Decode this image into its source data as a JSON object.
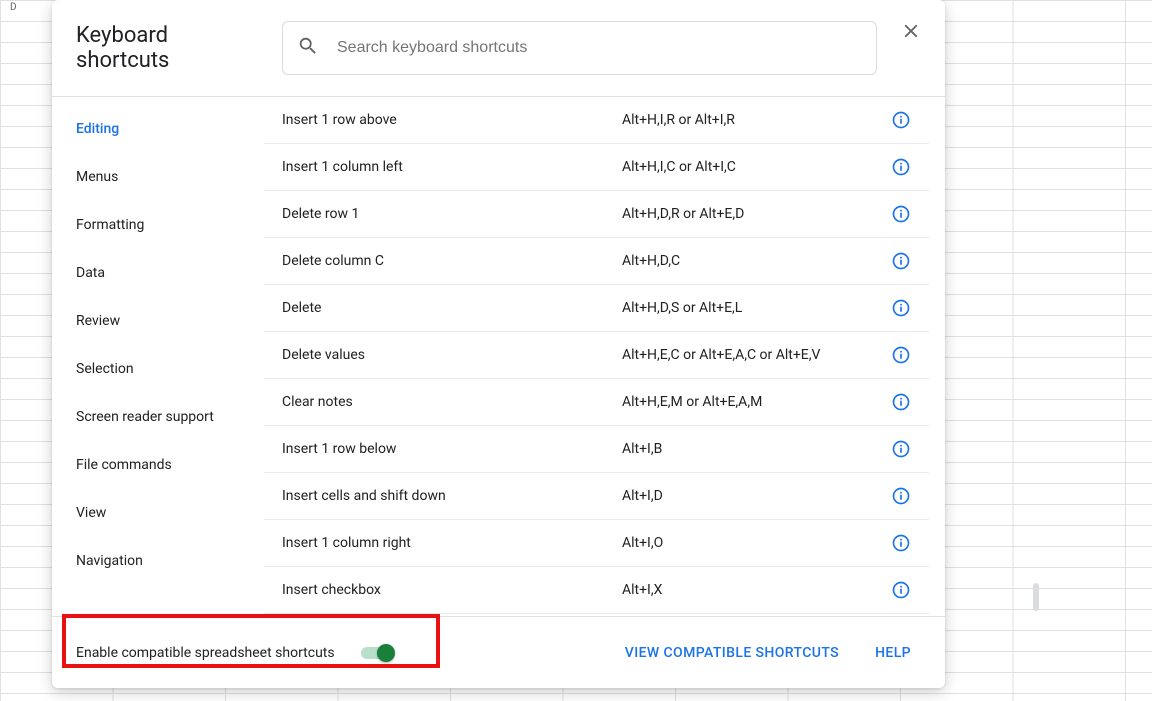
{
  "dialog": {
    "title": "Keyboard shortcuts",
    "search_placeholder": "Search keyboard shortcuts"
  },
  "sidebar": {
    "items": [
      {
        "label": "Editing",
        "active": true
      },
      {
        "label": "Menus",
        "active": false
      },
      {
        "label": "Formatting",
        "active": false
      },
      {
        "label": "Data",
        "active": false
      },
      {
        "label": "Review",
        "active": false
      },
      {
        "label": "Selection",
        "active": false
      },
      {
        "label": "Screen reader support",
        "active": false
      },
      {
        "label": "File commands",
        "active": false
      },
      {
        "label": "View",
        "active": false
      },
      {
        "label": "Navigation",
        "active": false
      }
    ]
  },
  "shortcuts": [
    {
      "action": "Insert 1 row above",
      "keys": "Alt+H,I,R or Alt+I,R"
    },
    {
      "action": "Insert 1 column left",
      "keys": "Alt+H,I,C or Alt+I,C"
    },
    {
      "action": "Delete row 1",
      "keys": "Alt+H,D,R or Alt+E,D"
    },
    {
      "action": "Delete column C",
      "keys": "Alt+H,D,C"
    },
    {
      "action": "Delete",
      "keys": "Alt+H,D,S or Alt+E,L"
    },
    {
      "action": "Delete values",
      "keys": "Alt+H,E,C or Alt+E,A,C or Alt+E,V"
    },
    {
      "action": "Clear notes",
      "keys": "Alt+H,E,M or Alt+E,A,M"
    },
    {
      "action": "Insert 1 row below",
      "keys": "Alt+I,B"
    },
    {
      "action": "Insert cells and shift down",
      "keys": "Alt+I,D"
    },
    {
      "action": "Insert 1 column right",
      "keys": "Alt+I,O"
    },
    {
      "action": "Insert checkbox",
      "keys": "Alt+I,X"
    }
  ],
  "footer": {
    "toggle_label": "Enable compatible spreadsheet shortcuts",
    "view_compatible": "VIEW COMPATIBLE SHORTCUTS",
    "help": "HELP"
  },
  "bg": {
    "col_d": "D"
  }
}
